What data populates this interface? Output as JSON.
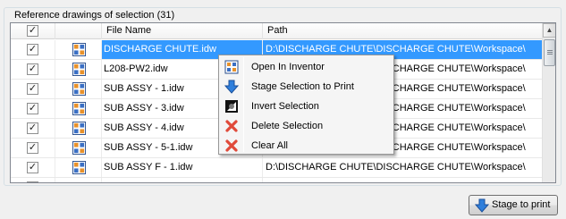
{
  "group": {
    "title": "Reference drawings of selection (31)"
  },
  "table": {
    "headers": {
      "file_name": "File Name",
      "path": "Path"
    },
    "rows": [
      {
        "name": "DISCHARGE CHUTE.idw",
        "path": "D:\\DISCHARGE CHUTE\\DISCHARGE CHUTE\\Workspace\\",
        "checked": true,
        "selected": true
      },
      {
        "name": "L208-PW2.idw",
        "path": "D:\\DISCHARGE CHUTE\\DISCHARGE CHUTE\\Workspace\\",
        "checked": true,
        "selected": false
      },
      {
        "name": "SUB ASSY - 1.idw",
        "path": "D:\\DISCHARGE CHUTE\\DISCHARGE CHUTE\\Workspace\\",
        "checked": true,
        "selected": false
      },
      {
        "name": "SUB ASSY - 3.idw",
        "path": "D:\\DISCHARGE CHUTE\\DISCHARGE CHUTE\\Workspace\\",
        "checked": true,
        "selected": false
      },
      {
        "name": "SUB ASSY - 4.idw",
        "path": "D:\\DISCHARGE CHUTE\\DISCHARGE CHUTE\\Workspace\\",
        "checked": true,
        "selected": false
      },
      {
        "name": "SUB ASSY - 5-1.idw",
        "path": "D:\\DISCHARGE CHUTE\\DISCHARGE CHUTE\\Workspace\\",
        "checked": true,
        "selected": false
      },
      {
        "name": "SUB ASSY F - 1.idw",
        "path": "D:\\DISCHARGE CHUTE\\DISCHARGE CHUTE\\Workspace\\",
        "checked": true,
        "selected": false
      }
    ]
  },
  "context_menu": {
    "items": [
      {
        "label": "Open In Inventor",
        "icon": "drawing-icon"
      },
      {
        "label": "Stage Selection to Print",
        "icon": "arrow-down-icon"
      },
      {
        "label": "Invert Selection",
        "icon": "invert-icon"
      },
      {
        "label": "Delete Selection",
        "icon": "red-x-icon"
      },
      {
        "label": "Clear All",
        "icon": "red-x-icon"
      }
    ]
  },
  "footer": {
    "stage_button_label": "Stage to print"
  },
  "colors": {
    "selection": "#3399ff",
    "accent_blue": "#2f7fdc",
    "delete_red": "#e04a3a"
  }
}
